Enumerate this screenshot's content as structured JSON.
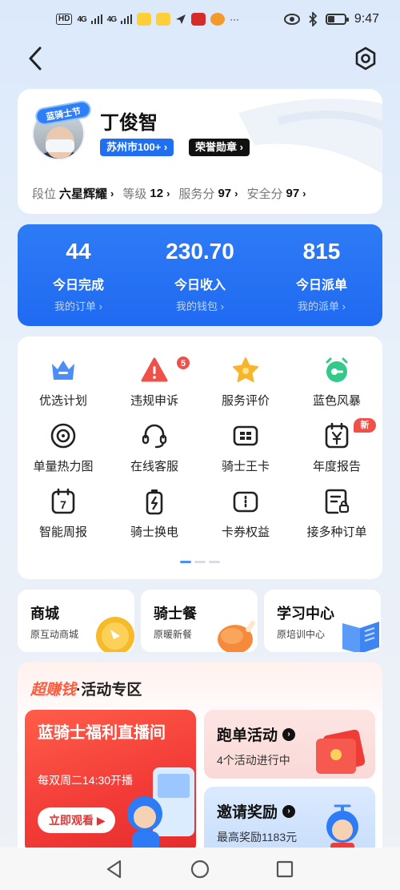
{
  "status_bar": {
    "left_hd": "HD",
    "signal_1": "4G",
    "signal_2": "4G",
    "more": "···",
    "time": "9:47",
    "battery_level": 0.35
  },
  "nav": {
    "back_icon": "chevron-left-icon",
    "settings_icon": "hexagon-settings-icon"
  },
  "profile": {
    "avatar_badge": "蓝骑士节",
    "name": "丁俊智",
    "city_tag": "苏州市100+ ›",
    "medal_tag": "荣誉勋章 ›",
    "stats": [
      {
        "key": "段位",
        "value": "六星辉耀"
      },
      {
        "key": "等级",
        "value": "12"
      },
      {
        "key": "服务分",
        "value": "97"
      },
      {
        "key": "安全分",
        "value": "97"
      }
    ]
  },
  "summary": [
    {
      "value": "44",
      "label": "今日完成",
      "link": "我的订单 ›"
    },
    {
      "value": "230.70",
      "label": "今日收入",
      "link": "我的钱包 ›"
    },
    {
      "value": "815",
      "label": "今日派单",
      "link": "我的派单 ›"
    }
  ],
  "services": [
    {
      "label": "优选计划",
      "icon": "crown-icon"
    },
    {
      "label": "违规申诉",
      "icon": "warning-icon",
      "badge": "5"
    },
    {
      "label": "服务评价",
      "icon": "star-icon"
    },
    {
      "label": "蓝色风暴",
      "icon": "alarm-clock-icon"
    },
    {
      "label": "单量热力图",
      "icon": "target-icon"
    },
    {
      "label": "在线客服",
      "icon": "headset-icon"
    },
    {
      "label": "骑士王卡",
      "icon": "card-icon"
    },
    {
      "label": "年度报告",
      "icon": "yuan-calendar-icon",
      "badge": "新"
    },
    {
      "label": "智能周报",
      "icon": "calendar-7-icon",
      "badge_text": "7"
    },
    {
      "label": "骑士换电",
      "icon": "battery-swap-icon"
    },
    {
      "label": "卡券权益",
      "icon": "coupon-icon"
    },
    {
      "label": "接多种订单",
      "icon": "order-doc-icon"
    }
  ],
  "pager": {
    "pages": 3,
    "current": 1
  },
  "tiles": [
    {
      "title": "商城",
      "sub": "原互动商城"
    },
    {
      "title": "骑士餐",
      "sub": "原暖新餐"
    },
    {
      "title": "学习中心",
      "sub": "原培训中心"
    }
  ],
  "activity": {
    "title_hot": "超赚钱",
    "title_rest": "·活动专区",
    "live": {
      "title": "蓝骑士福利直播间",
      "sub": "每双周二14:30开播",
      "button": "立即观看"
    },
    "run": {
      "title": "跑单活动",
      "sub": "4个活动进行中"
    },
    "invite": {
      "title": "邀请奖励",
      "sub": "最高奖励1183元"
    }
  },
  "colors": {
    "primary_blue": "#1f6af1",
    "hot_red": "#f23a36",
    "accent_orange": "#ff5a3c"
  }
}
